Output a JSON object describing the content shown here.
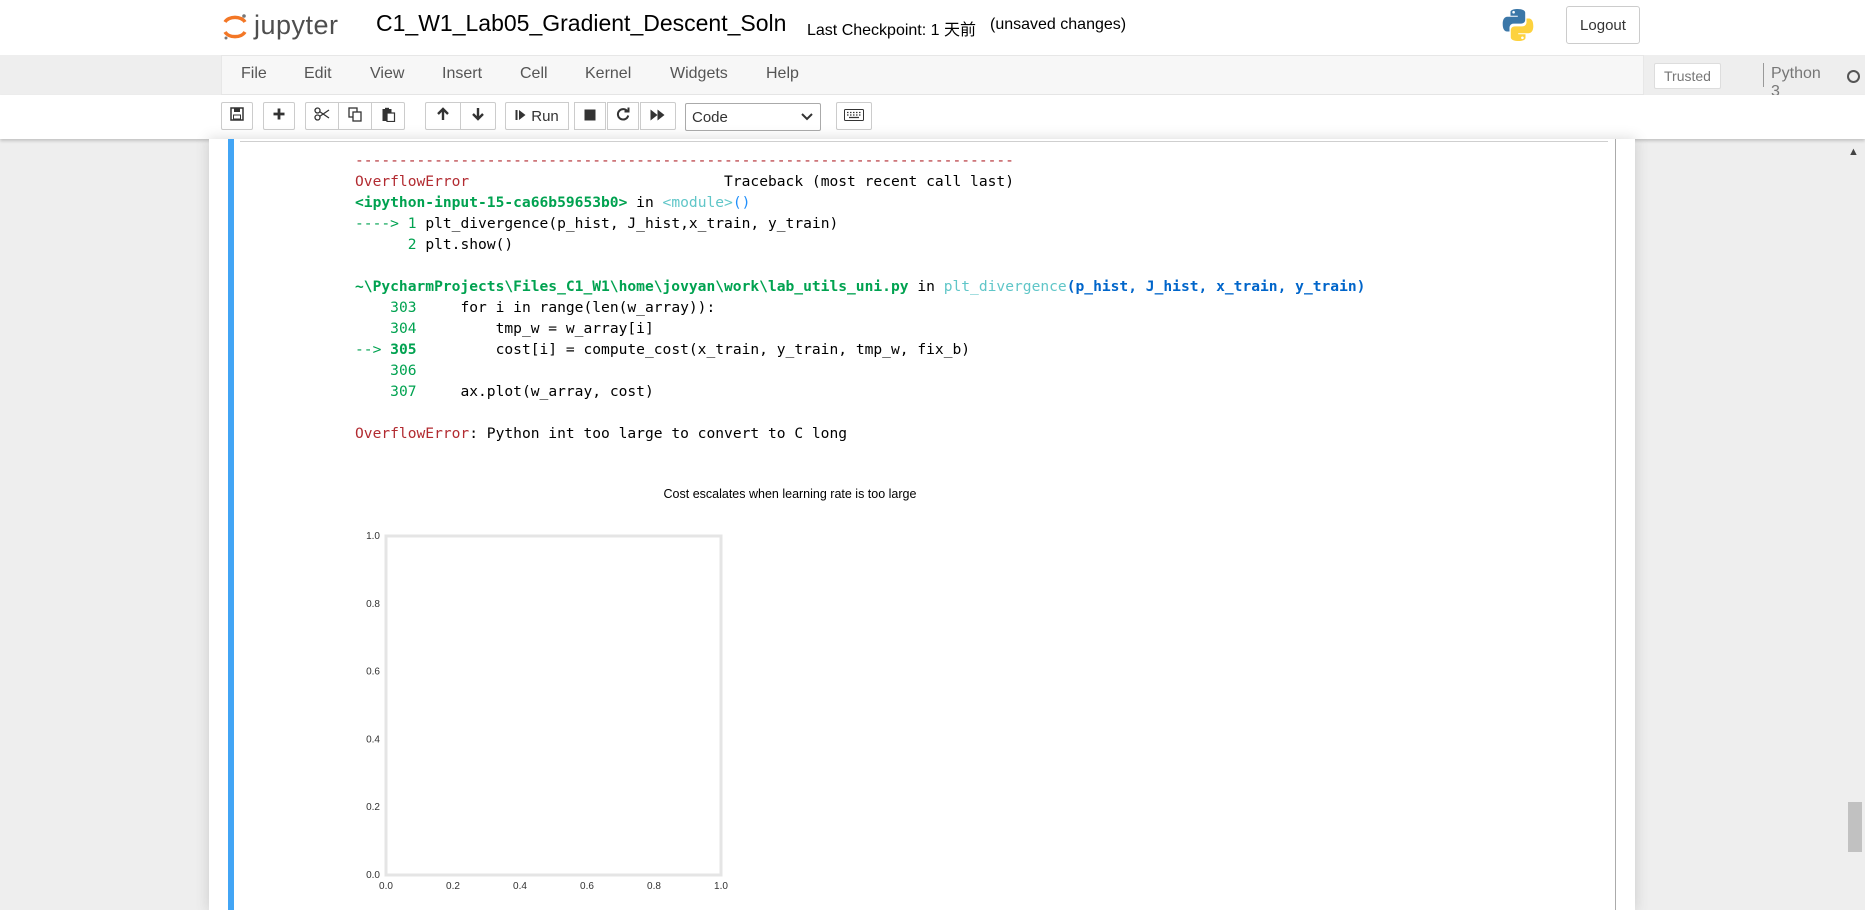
{
  "header": {
    "logo_text": "jupyter",
    "notebook_title": "C1_W1_Lab05_Gradient_Descent_Soln",
    "checkpoint": "Last Checkpoint: 1 天前",
    "unsaved": "(unsaved changes)",
    "logout_label": "Logout",
    "python_logo_icon": "python-logo-icon"
  },
  "menubar": {
    "items": [
      "File",
      "Edit",
      "View",
      "Insert",
      "Cell",
      "Kernel",
      "Widgets",
      "Help"
    ],
    "trusted_label": "Trusted",
    "kernel_name": "Python 3"
  },
  "toolbar": {
    "run_label": "Run",
    "cell_type": "Code",
    "icons": [
      "save-icon",
      "plus-icon",
      "cut-icon",
      "copy-icon",
      "paste-icon",
      "arrow-up-icon",
      "arrow-down-icon",
      "step-forward-icon",
      "stop-icon",
      "restart-icon",
      "fast-forward-icon",
      "keyboard-icon"
    ]
  },
  "traceback": {
    "separator": "---------------------------------------------------------------------------",
    "error_name": "OverflowError",
    "traceback_header": "Traceback (most recent call last)",
    "input_ref": "<ipython-input-15-ca66b59653b0>",
    "in_word": "in",
    "module_ref": "<module>",
    "parens": "()",
    "line1_arrow": "----> 1",
    "line1_code": "plt_divergence(p_hist, J_hist,x_train, y_train)",
    "line2_num": "2",
    "line2_code": "plt.show()",
    "file_path": "~\\PycharmProjects\\Files_C1_W1\\home\\jovyan\\work\\lab_utils_uni.py",
    "func_name": "plt_divergence",
    "func_args": "(p_hist, J_hist, x_train, y_train)",
    "l303_num": "303",
    "l303_code": "for i in range(len(w_array)):",
    "l304_num": "304",
    "l304_code": "tmp_w = w_array[i]",
    "l305_arrow": "-->",
    "l305_num": "305",
    "l305_code": "cost[i] = compute_cost(x_train, y_train, tmp_w, fix_b)",
    "l306_num": "306",
    "l307_num": "307",
    "l307_code": "ax.plot(w_array, cost)",
    "final_msg": ": Python int too large to convert to C long"
  },
  "chart_data": {
    "type": "line",
    "title": "Cost escalates when learning rate is too large",
    "xlim": [
      0.0,
      1.0
    ],
    "ylim": [
      0.0,
      1.0
    ],
    "xticks": [
      "0.0",
      "0.2",
      "0.4",
      "0.6",
      "0.8",
      "1.0"
    ],
    "yticks": [
      "0.0",
      "0.2",
      "0.4",
      "0.6",
      "0.8",
      "1.0"
    ],
    "series": [],
    "grid": false
  }
}
